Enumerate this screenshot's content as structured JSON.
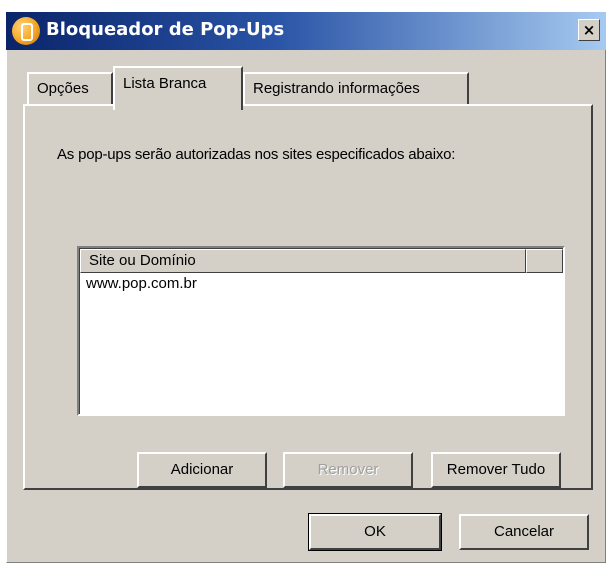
{
  "window": {
    "title": "Bloqueador de Pop-Ups",
    "close_glyph": "×",
    "icon": "popup-blocker-icon"
  },
  "tabs": [
    {
      "label": "Opções",
      "active": false
    },
    {
      "label": "Lista Branca",
      "active": true
    },
    {
      "label": "Registrando informações",
      "active": false
    }
  ],
  "panel": {
    "description": "As pop-ups serão autorizadas nos sites especificados abaixo:",
    "list": {
      "columns": [
        "Site ou Domínio",
        ""
      ],
      "rows": [
        "www.pop.com.br"
      ]
    },
    "buttons": {
      "add": "Adicionar",
      "remove": "Remover",
      "remove_all": "Remover Tudo"
    }
  },
  "footer": {
    "ok": "OK",
    "cancel": "Cancelar"
  },
  "colors": {
    "title_start": "#0a246a",
    "title_end": "#a6caf0",
    "dialog_face": "#d4d0c8"
  }
}
